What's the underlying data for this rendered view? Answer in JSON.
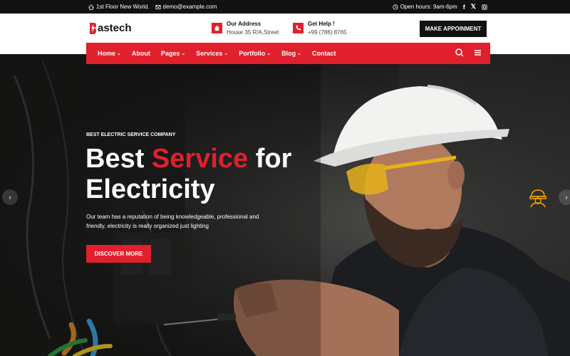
{
  "topbar": {
    "address": "1st Floor New World.",
    "email": "demo@example.com",
    "hours": "Open hours: 9am-6pm",
    "social": [
      "facebook-icon",
      "x-icon",
      "instagram-icon"
    ]
  },
  "header": {
    "logo_text": "astech",
    "address_title": "Our Address",
    "address_value": "House 35 R/A,Street",
    "help_title": "Get Help !",
    "help_value": "+99 (786) 8765",
    "cta_label": "MAKE APPOINMENT"
  },
  "nav": {
    "items": [
      {
        "label": "Home",
        "dropdown": true
      },
      {
        "label": "About",
        "dropdown": false
      },
      {
        "label": "Pages",
        "dropdown": true
      },
      {
        "label": "Services",
        "dropdown": true
      },
      {
        "label": "Portfolio",
        "dropdown": true
      },
      {
        "label": "Blog",
        "dropdown": true
      },
      {
        "label": "Contact",
        "dropdown": false
      }
    ]
  },
  "hero": {
    "tagline": "BEST ELECTRIC SERVICE COMPANY",
    "title_part1": "Best ",
    "title_accent": "Service",
    "title_part2": " for",
    "title_line2": "Electricity",
    "description": "Our team has a reputation of being knowledgeable, professional and friendly, electricity is really organized just lighting",
    "button_label": "DISCOVER MORE"
  },
  "colors": {
    "accent": "#e0202c",
    "dark": "#111111",
    "helmet_icon": "#f5a300"
  }
}
